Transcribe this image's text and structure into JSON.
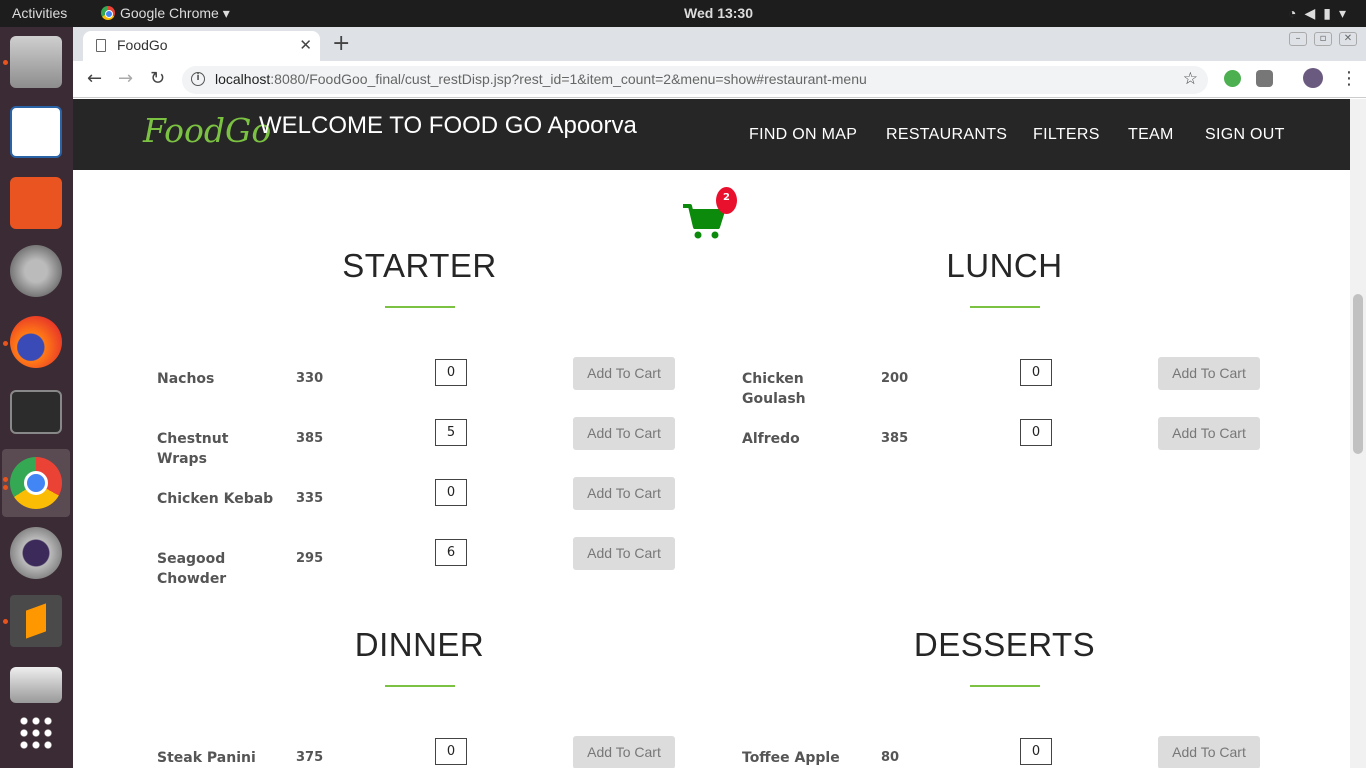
{
  "os": {
    "activities": "Activities",
    "app_name": "Google Chrome",
    "clock": "Wed 13:30"
  },
  "browser": {
    "tab_title": "FoodGo",
    "url_host": "localhost",
    "url_rest": ":8080/FoodGoo_final/cust_restDisp.jsp?rest_id=1&item_count=2&menu=show#restaurant-menu"
  },
  "site": {
    "brand": "FoodGo",
    "welcome": "WELCOME TO FOOD GO Apoorva",
    "nav": [
      "FIND ON MAP",
      "RESTAURANTS",
      "FILTERS",
      "TEAM",
      "SIGN OUT"
    ],
    "cart_count": "2",
    "add_label": "Add To Cart"
  },
  "menu": {
    "starter": {
      "title": "STARTER",
      "items": [
        {
          "name": "Nachos",
          "price": "330",
          "qty": "0"
        },
        {
          "name": "Chestnut Wraps",
          "price": "385",
          "qty": "5"
        },
        {
          "name": "Chicken Kebab",
          "price": "335",
          "qty": "0"
        },
        {
          "name": "Seagood Chowder",
          "price": "295",
          "qty": "6"
        }
      ]
    },
    "lunch": {
      "title": "LUNCH",
      "items": [
        {
          "name": "Chicken Goulash",
          "price": "200",
          "qty": "0"
        },
        {
          "name": "Alfredo",
          "price": "385",
          "qty": "0"
        }
      ]
    },
    "dinner": {
      "title": "DINNER",
      "items": [
        {
          "name": "Steak Panini",
          "price": "375",
          "qty": "0"
        }
      ]
    },
    "desserts": {
      "title": "DESSERTS",
      "items": [
        {
          "name": "Toffee Apple",
          "price": "80",
          "qty": "0"
        }
      ]
    }
  }
}
